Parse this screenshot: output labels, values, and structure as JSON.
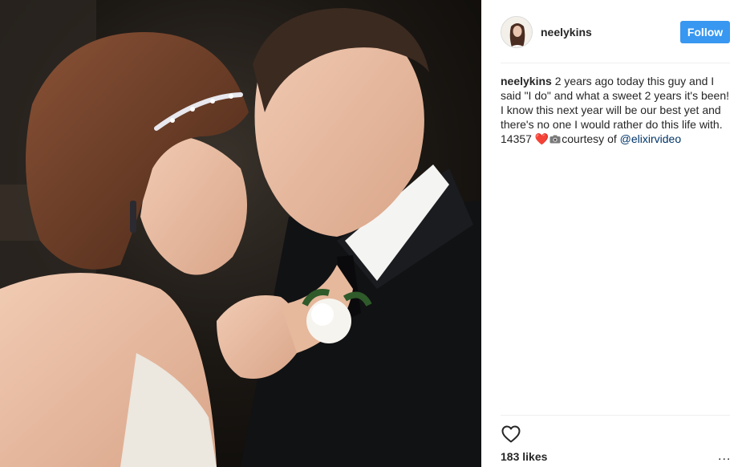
{
  "post": {
    "photo_name": "wedding-dance-photo",
    "author": {
      "username": "neelykins",
      "follow_label": "Follow"
    },
    "caption": {
      "username": "neelykins",
      "text": "2 years ago today this guy and I said \"I do\" and what a sweet 2 years it's been! I know this next year will be our best yet and there's no one I would rather do this life with. 14357",
      "emoji_heart": "❤️",
      "after_camera": "courtesy of",
      "mention": "@elixirvideo"
    },
    "likes_text": "183 likes",
    "more_label": "..."
  },
  "colors": {
    "follow_button": "#3897f0",
    "mention": "#003569",
    "divider": "#efefef"
  }
}
